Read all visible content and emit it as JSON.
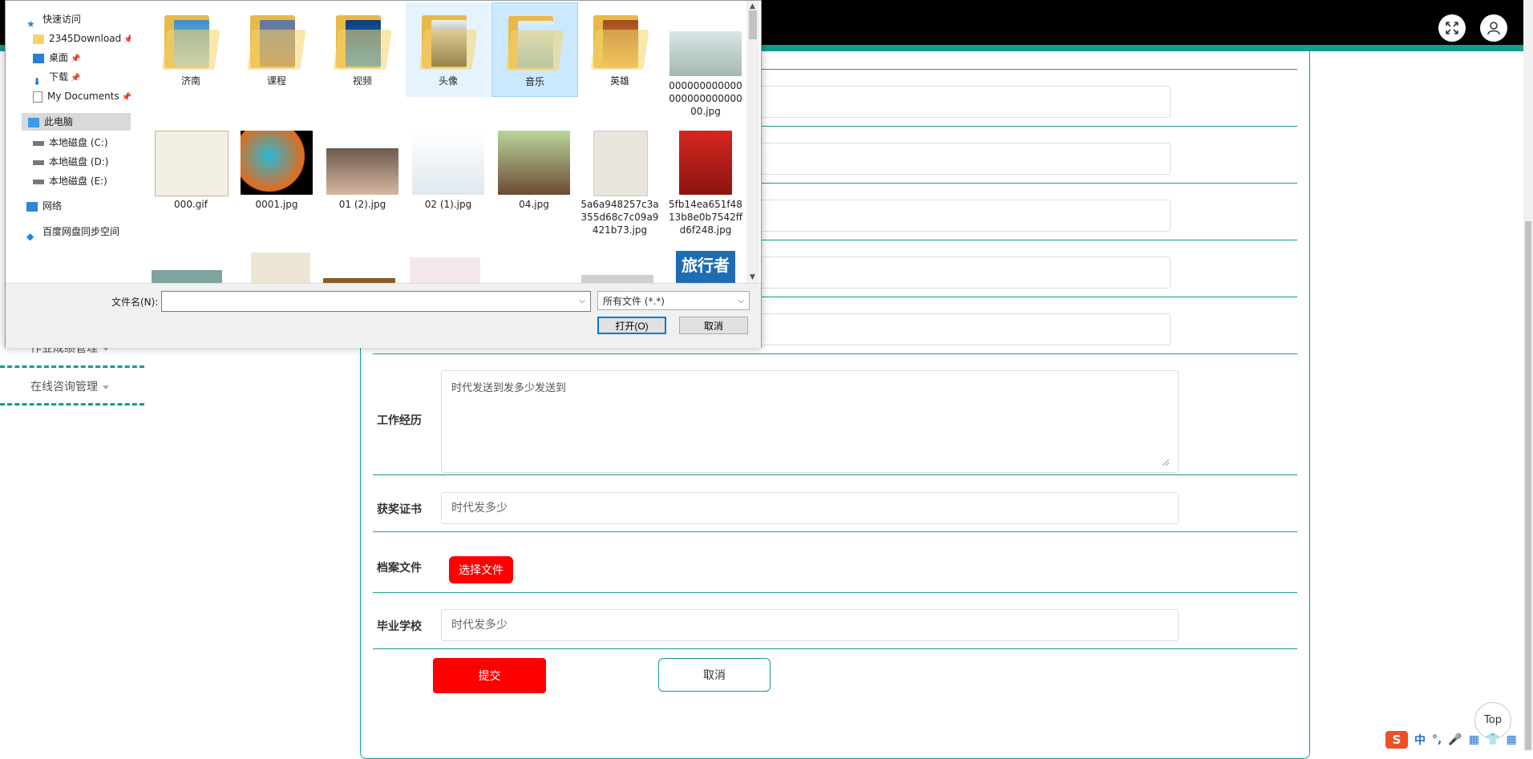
{
  "sidebar": {
    "items": [
      {
        "label": "作业成绩管理"
      },
      {
        "label": "在线咨询管理"
      }
    ]
  },
  "form": {
    "work_history": {
      "label": "工作经历",
      "value": "时代发送到发多少发送到"
    },
    "awards": {
      "label": "获奖证书",
      "value": "时代发多少"
    },
    "archive": {
      "label": "档案文件",
      "button": "选择文件"
    },
    "school": {
      "label": "毕业学校",
      "value": "时代发多少"
    },
    "submit": "提交",
    "cancel": "取消"
  },
  "top_button": "Top",
  "ime": {
    "logo": "S",
    "lang": "中"
  },
  "dialog": {
    "nav": [
      {
        "label": "快速访问",
        "icon": "star-icon"
      },
      {
        "label": "2345Download",
        "icon": "folder-icon",
        "pinned": true
      },
      {
        "label": "桌面",
        "icon": "desktop-icon",
        "pinned": true
      },
      {
        "label": "下载",
        "icon": "download-icon",
        "pinned": true
      },
      {
        "label": "My Documents",
        "icon": "document-icon",
        "pinned": true
      },
      {
        "label": "此电脑",
        "icon": "computer-icon"
      },
      {
        "label": "本地磁盘 (C:)",
        "icon": "drive-icon"
      },
      {
        "label": "本地磁盘 (D:)",
        "icon": "drive-icon"
      },
      {
        "label": "本地磁盘 (E:)",
        "icon": "drive-icon"
      },
      {
        "label": "网络",
        "icon": "network-icon"
      },
      {
        "label": "百度网盘同步空间",
        "icon": "baidu-cloud-icon"
      }
    ],
    "pin_glyph": "📌",
    "files": [
      {
        "name": "济南",
        "kind": "folder"
      },
      {
        "name": "课程",
        "kind": "folder"
      },
      {
        "name": "视频",
        "kind": "folder"
      },
      {
        "name": "头像",
        "kind": "folder"
      },
      {
        "name": "音乐",
        "kind": "folder"
      },
      {
        "name": "英雄",
        "kind": "folder"
      },
      {
        "name": "00000000000000000000000000.jpg",
        "kind": "image"
      },
      {
        "name": "000.gif",
        "kind": "image"
      },
      {
        "name": "0001.jpg",
        "kind": "image"
      },
      {
        "name": "01 (2).jpg",
        "kind": "image"
      },
      {
        "name": "02 (1).jpg",
        "kind": "image"
      },
      {
        "name": "04.jpg",
        "kind": "image"
      },
      {
        "name": "5a6a948257c3a355d68c7c09a9421b73.jpg",
        "kind": "image"
      },
      {
        "name": "5fb14ea651f4813b8e0b7542ffd6f248.jpg",
        "kind": "image"
      }
    ],
    "book_cover_text": "旅行者",
    "filename_label": "文件名(N):",
    "filename_value": "",
    "filetype": "所有文件 (*.*)",
    "open": "打开(O)",
    "cancel": "取消"
  },
  "colors": {
    "accent": "#169c8c",
    "red": "#ff0000",
    "black": "#000000"
  }
}
